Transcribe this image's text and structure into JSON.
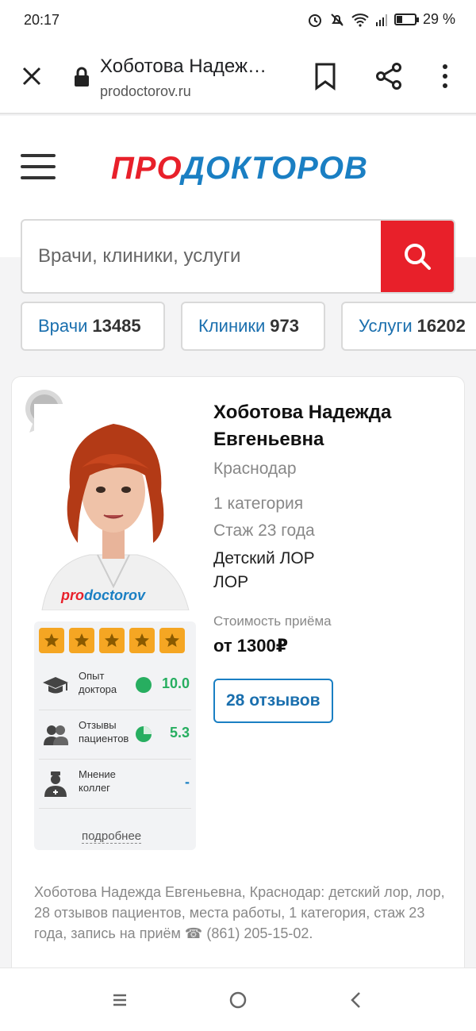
{
  "status": {
    "time": "20:17",
    "battery": "29 %",
    "battery_level": 0.29
  },
  "browser": {
    "page_title": "Хоботова Надеж…",
    "domain": "prodoctorov.ru"
  },
  "site": {
    "logo_part1": "ПРО",
    "logo_part2": "ДОКТОРОВ",
    "search_placeholder": "Врачи, клиники, услуги",
    "chips": [
      {
        "label": "Врачи",
        "count": "13485"
      },
      {
        "label": "Клиники",
        "count": "973"
      },
      {
        "label": "Услуги",
        "count": "16202"
      }
    ]
  },
  "doctor": {
    "name": "Хоботова Надежда Евгеньевна",
    "city": "Краснодар",
    "category": "1 категория",
    "experience": "Стаж 23 года",
    "specialties": [
      "Детский ЛОР",
      "ЛОР"
    ],
    "price_label": "Стоимость приёма",
    "price": "от 1300₽",
    "reviews_button": "28 отзывов",
    "photo_watermark_1": "pro",
    "photo_watermark_2": "doctorov",
    "stars": 5,
    "ratings": [
      {
        "label_1": "Опыт",
        "label_2": "доктора",
        "value": "10.0",
        "icon": "graduation-cap-icon"
      },
      {
        "label_1": "Отзывы",
        "label_2": "пациентов",
        "value": "5.3",
        "icon": "people-icon"
      },
      {
        "label_1": "Мнение",
        "label_2": "коллег",
        "value": "-",
        "icon": "doctor-icon"
      }
    ],
    "more_link": "подробнее",
    "description": "Хоботова Надежда Евгеньевна, Краснодар: детский лор, лор, 28 отзывов пациентов, места работы, 1 категория, стаж 23 года, запись на приём ☎ (861) 205-15-02."
  },
  "colors": {
    "brand_red": "#e8202a",
    "brand_blue": "#1a7fc3",
    "star": "#f5a623",
    "rating_green": "#27ae60"
  }
}
